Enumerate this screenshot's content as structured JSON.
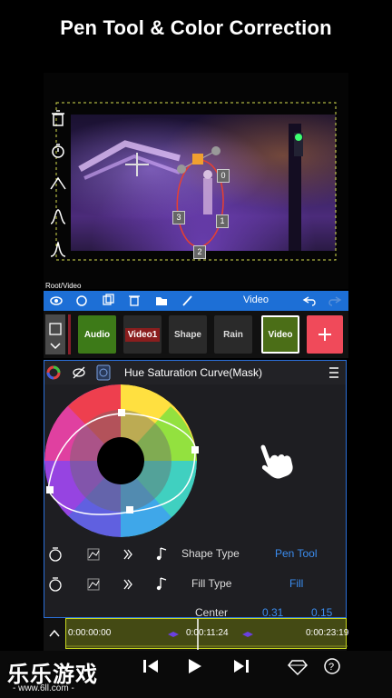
{
  "header": {
    "title": "Pen Tool & Color Correction"
  },
  "preview": {
    "breadcrumb": "Root/Video",
    "point_labels": [
      "0",
      "3",
      "1",
      "2"
    ]
  },
  "toolbar": {
    "label": "Video"
  },
  "clips": [
    {
      "label": "Audio",
      "color": "#3d7a18"
    },
    {
      "label": "Video1",
      "color": "#8a1e1e"
    },
    {
      "label": "Shape",
      "color": "#2a2a2a"
    },
    {
      "label": "Rain",
      "color": "#2a2a2a"
    },
    {
      "label": "Video",
      "color": "#4b6e17"
    }
  ],
  "panel": {
    "title": "Hue Saturation Curve(Mask)",
    "rows": [
      {
        "label": "Shape Type",
        "value": "Pen Tool"
      },
      {
        "label": "Fill Type",
        "value": "Fill"
      },
      {
        "label": "Center",
        "value1": "0.31",
        "value2": "0.15"
      }
    ]
  },
  "timeline": {
    "start": "0:00:00:00",
    "current": "0:00:11:24",
    "end": "0:00:23:19"
  },
  "watermark": {
    "text": "乐乐游戏",
    "url": "- www.6ll.com -"
  },
  "colors": {
    "accent": "#1d6fd6",
    "value_blue": "#3b8df0",
    "add_button": "#f04a5a",
    "track": "#444a14"
  }
}
